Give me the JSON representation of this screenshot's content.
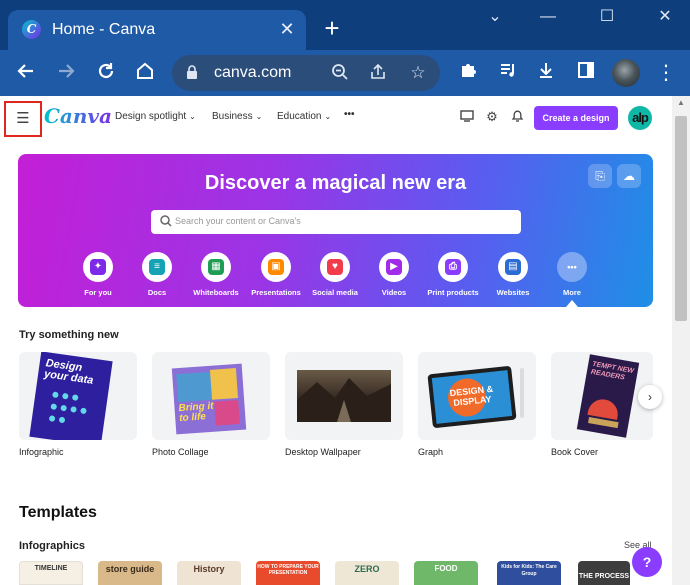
{
  "browser": {
    "tab_title": "Home - Canva",
    "tab_close": "✕",
    "new_tab": "+",
    "url": "canva.com",
    "window": {
      "minimize": "⌄",
      "restore": "—",
      "maximize": "☐",
      "close": "✕"
    }
  },
  "header": {
    "menu_icon": "☰",
    "logo": "Canva",
    "nav": [
      {
        "label": "Design spotlight"
      },
      {
        "label": "Business"
      },
      {
        "label": "Education"
      }
    ],
    "more_icon": "•••",
    "create_button": "Create a design",
    "avatar_initials": "alp"
  },
  "hero": {
    "title": "Discover a magical new era",
    "search_placeholder": "Search your content or Canva's",
    "categories": [
      {
        "label": "For you",
        "color": "#7d2ae8",
        "glyph": "✦"
      },
      {
        "label": "Docs",
        "color": "#13a3b5",
        "glyph": "≡"
      },
      {
        "label": "Whiteboards",
        "color": "#1f9d55",
        "glyph": "▦"
      },
      {
        "label": "Presentations",
        "color": "#ff8a00",
        "glyph": "▣"
      },
      {
        "label": "Social media",
        "color": "#f23b4b",
        "glyph": "♥"
      },
      {
        "label": "Videos",
        "color": "#a12be8",
        "glyph": "▶"
      },
      {
        "label": "Print products",
        "color": "#8b3dff",
        "glyph": "⎙"
      },
      {
        "label": "Websites",
        "color": "#2b6cd4",
        "glyph": "▤"
      },
      {
        "label": "More",
        "color": "#8a93a3",
        "glyph": "•••"
      }
    ]
  },
  "try_something_new": {
    "title": "Try something new",
    "cards": [
      {
        "label": "Infographic",
        "art_text": "Design your data"
      },
      {
        "label": "Photo Collage",
        "art_text": "Bring it to life"
      },
      {
        "label": "Desktop Wallpaper",
        "art_text": ""
      },
      {
        "label": "Graph",
        "art_text": "DESIGN & DISPLAY"
      },
      {
        "label": "Book Cover",
        "art_text": "TEMPT NEW READERS"
      }
    ],
    "next_icon": "›"
  },
  "templates": {
    "title": "Templates",
    "infographics_title": "Infographics",
    "see_all": "See all",
    "thumbs": [
      {
        "text": "TIMELINE",
        "bg": "#f6f0e4",
        "fg": "#333333"
      },
      {
        "text": "store guide",
        "bg": "#d9b98a",
        "fg": "#3a2a1a"
      },
      {
        "text": "History",
        "bg": "#efe3d3",
        "fg": "#5a3a2a"
      },
      {
        "text": "HOW TO PREPARE YOUR PRESENTATION",
        "bg": "#e84b2c",
        "fg": "#ffffff"
      },
      {
        "text": "ZERO",
        "bg": "#efe7d6",
        "fg": "#2d6a4f"
      },
      {
        "text": "FOOD",
        "bg": "#6fb86a",
        "fg": "#ffffff"
      },
      {
        "text": "Kids for Kids: The Care Group",
        "bg": "#2f4f9e",
        "fg": "#ffffff"
      },
      {
        "text": "THE PROCESS",
        "bg": "#3d3d3d",
        "fg": "#ffffff"
      }
    ]
  },
  "help_label": "?"
}
